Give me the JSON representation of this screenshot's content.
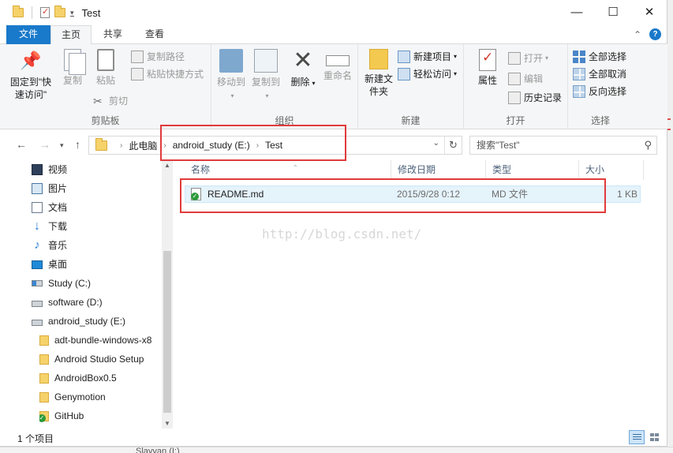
{
  "window": {
    "title": "Test",
    "controls": {
      "minimize": "—",
      "maximize": "☐",
      "close": "✕"
    }
  },
  "ribbon_tabs": [
    {
      "label": "文件"
    },
    {
      "label": "主页"
    },
    {
      "label": "共享"
    },
    {
      "label": "查看"
    }
  ],
  "ribbon": {
    "clipboard": {
      "label": "剪贴板",
      "pin": "固定到\"快速访问\"",
      "copy": "复制",
      "paste": "粘贴",
      "copy_path": "复制路径",
      "paste_shortcut": "粘贴快捷方式",
      "cut": "剪切"
    },
    "organize": {
      "label": "组织",
      "move_to": "移动到",
      "copy_to": "复制到",
      "delete": "删除",
      "rename": "重命名"
    },
    "new": {
      "label": "新建",
      "new_folder": "新建文件夹",
      "new_item": "新建项目",
      "easy_access": "轻松访问"
    },
    "open": {
      "label": "打开",
      "properties": "属性",
      "open": "打开",
      "edit": "编辑",
      "history": "历史记录"
    },
    "select": {
      "label": "选择",
      "select_all": "全部选择",
      "select_none": "全部取消",
      "invert": "反向选择"
    }
  },
  "address": {
    "crumbs": [
      "此电脑",
      "android_study (E:)",
      "Test"
    ]
  },
  "search": {
    "placeholder": "搜索\"Test\""
  },
  "nav_pane": [
    {
      "label": "视频",
      "icon": "video-icon"
    },
    {
      "label": "图片",
      "icon": "pictures-icon"
    },
    {
      "label": "文档",
      "icon": "documents-icon"
    },
    {
      "label": "下载",
      "icon": "download-icon"
    },
    {
      "label": "音乐",
      "icon": "music-icon"
    },
    {
      "label": "桌面",
      "icon": "desktop-icon"
    },
    {
      "label": "Study (C:)",
      "icon": "drive-c-icon"
    },
    {
      "label": "software (D:)",
      "icon": "drive-icon"
    },
    {
      "label": "android_study (E:)",
      "icon": "drive-icon"
    },
    {
      "label": "adt-bundle-windows-x8",
      "icon": "folder-icon"
    },
    {
      "label": "Android Studio Setup",
      "icon": "folder-icon"
    },
    {
      "label": "AndroidBox0.5",
      "icon": "folder-icon"
    },
    {
      "label": "Genymotion",
      "icon": "folder-icon"
    },
    {
      "label": "GitHub",
      "icon": "github-folder-icon"
    }
  ],
  "columns": {
    "name": "名称",
    "modified": "修改日期",
    "type": "类型",
    "size": "大小"
  },
  "files": [
    {
      "name": "README.md",
      "modified": "2015/9/28 0:12",
      "type": "MD 文件",
      "size": "1 KB"
    }
  ],
  "watermark": "http://blog.csdn.net/",
  "status": {
    "count": "1 个项目"
  },
  "background_peek": "Slayyan (I:)",
  "colors": {
    "accent": "#1979ca",
    "selection": "#e5f3fb",
    "annotation_red": "#e03b3b",
    "folder": "#f6d26b"
  }
}
